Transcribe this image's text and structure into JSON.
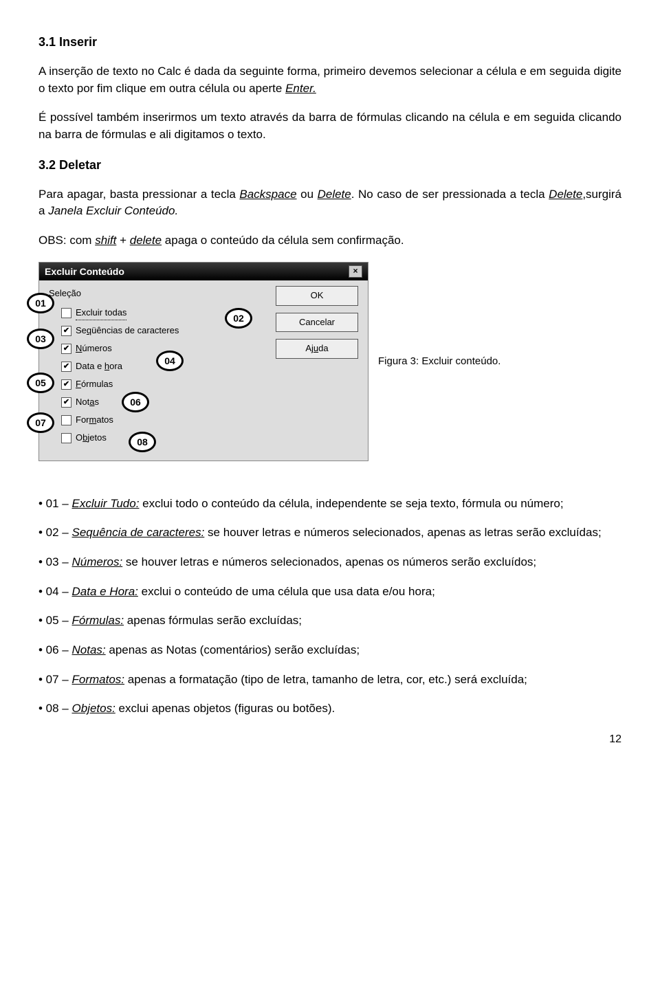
{
  "section1": {
    "heading": "3.1 Inserir",
    "para1_prefix": "A inserção de texto no Calc é dada da seguinte forma, primeiro devemos selecionar a célula e em seguida digite o texto por fim clique em outra célula ou aperte ",
    "para1_enter": "Enter.",
    "para2": "É possível também inserirmos um texto através da barra de fórmulas clicando na célula e em seguida clicando na barra de fórmulas e ali digitamos o texto."
  },
  "section2": {
    "heading": "3.2 Deletar",
    "para1_a": "Para apagar, basta pressionar a tecla ",
    "para1_back": "Backspace",
    "para1_b": " ou ",
    "para1_del": "Delete",
    "para1_c": ". No caso de ser pressionada a tecla ",
    "para1_del2": "Delete",
    "para1_d": ",surgirá a ",
    "para1_win": "Janela Excluir Conteúdo.",
    "obs_a": "OBS: com ",
    "obs_shift": "shift",
    "obs_b": " + ",
    "obs_del": "delete",
    "obs_c": " apaga o conteúdo da célula sem confirmação."
  },
  "dialog": {
    "title": "Excluir Conteúdo",
    "group": "Seleção",
    "opts": {
      "o1": "Excluir todas",
      "o2_pre": "Se",
      "o2_ul": "q",
      "o2_post": "üências de caracteres",
      "o3_ul": "N",
      "o3_post": "úmeros",
      "o4_pre": "Data e ",
      "o4_ul": "h",
      "o4_post": "ora",
      "o5_ul": "F",
      "o5_post": "órmulas",
      "o6_pre": "Not",
      "o6_ul": "a",
      "o6_post": "s",
      "o7_pre": "For",
      "o7_ul": "m",
      "o7_post": "atos",
      "o8_pre": "O",
      "o8_ul": "b",
      "o8_post": "jetos"
    },
    "btn_ok": "OK",
    "btn_cancel": "Cancelar",
    "btn_help_pre": "Aj",
    "btn_help_ul": "u",
    "btn_help_post": "da",
    "badges": {
      "b1": "01",
      "b2": "02",
      "b3": "03",
      "b4": "04",
      "b5": "05",
      "b6": "06",
      "b7": "07",
      "b8": "08"
    }
  },
  "figcaption": "Figura 3:  Excluir conteúdo.",
  "bullets": {
    "i1_a": "• 01 – ",
    "i1_term": "Excluir Tudo:",
    "i1_b": " exclui todo o conteúdo da célula, independente se seja texto, fórmula ou número;",
    "i2_a": "• 02 – ",
    "i2_term": "Sequência de caracteres:",
    "i2_b": " se houver letras e números selecionados, apenas as letras serão excluídas;",
    "i3_a": "• 03 – ",
    "i3_term": "Números:",
    "i3_b": " se houver letras e números selecionados, apenas os números serão excluídos;",
    "i4_a": "• 04 – ",
    "i4_term": "Data e Hora:",
    "i4_b": " exclui o conteúdo de uma célula que usa data e/ou hora;",
    "i5_a": "• 05 – ",
    "i5_term": "Fórmulas:",
    "i5_b": " apenas fórmulas serão excluídas;",
    "i6_a": "• 06 – ",
    "i6_term": "Notas:",
    "i6_b": " apenas as Notas (comentários) serão excluídas;",
    "i7_a": "• 07 – ",
    "i7_term": "Formatos:",
    "i7_b": " apenas a formatação (tipo de letra, tamanho de letra, cor, etc.) será excluída;",
    "i8_a": "• 08 – ",
    "i8_term": "Objetos:",
    "i8_b": " exclui apenas objetos (figuras ou botões)."
  },
  "pagenum": "12"
}
